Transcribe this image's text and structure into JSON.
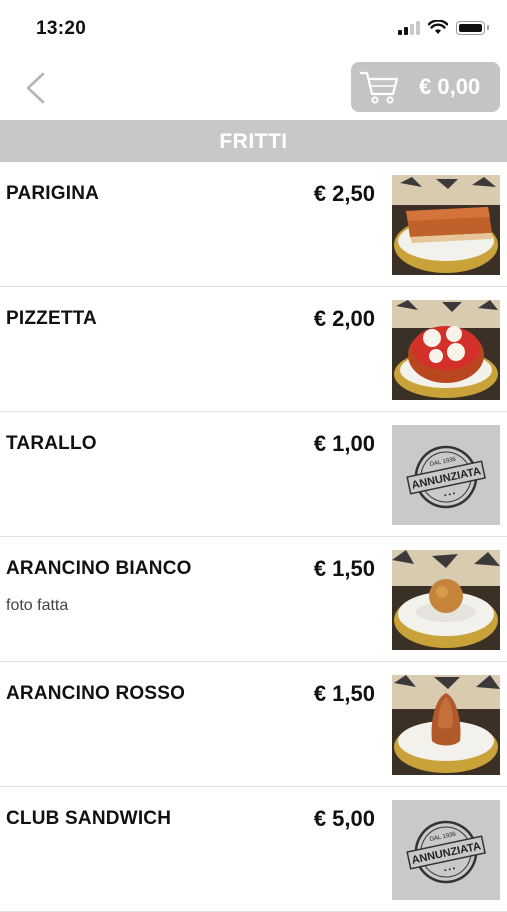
{
  "status": {
    "time": "13:20"
  },
  "cart": {
    "total": "€ 0,00"
  },
  "section": {
    "title": "FRITTI"
  },
  "items": [
    {
      "name": "PARIGINA",
      "price": "€ 2,50",
      "desc": "",
      "image": "parigina-photo"
    },
    {
      "name": "PIZZETTA",
      "price": "€ 2,00",
      "desc": "",
      "image": "pizzetta-photo"
    },
    {
      "name": "TARALLO",
      "price": "€ 1,00",
      "desc": "",
      "image": "annunziata-logo-placeholder"
    },
    {
      "name": "ARANCINO BIANCO",
      "price": "€ 1,50",
      "desc": "foto fatta",
      "image": "arancino-bianco-photo"
    },
    {
      "name": "ARANCINO ROSSO",
      "price": "€ 1,50",
      "desc": "",
      "image": "arancino-rosso-photo"
    },
    {
      "name": "CLUB SANDWICH",
      "price": "€ 5,00",
      "desc": "",
      "image": "annunziata-logo-placeholder"
    }
  ],
  "logo": {
    "top": "DAL 1936",
    "main": "ANNUNZIATA"
  }
}
